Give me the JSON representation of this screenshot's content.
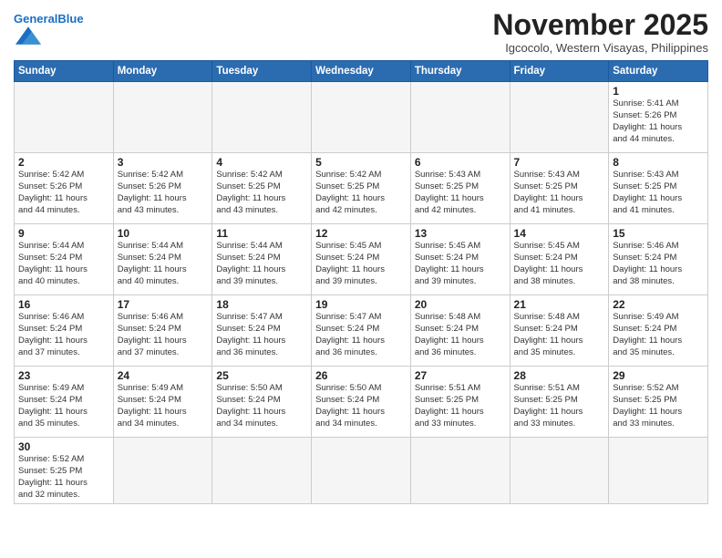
{
  "header": {
    "logo_general": "General",
    "logo_blue": "Blue",
    "month_title": "November 2025",
    "location": "Igcocolo, Western Visayas, Philippines"
  },
  "weekdays": [
    "Sunday",
    "Monday",
    "Tuesday",
    "Wednesday",
    "Thursday",
    "Friday",
    "Saturday"
  ],
  "weeks": [
    [
      {
        "day": "",
        "info": ""
      },
      {
        "day": "",
        "info": ""
      },
      {
        "day": "",
        "info": ""
      },
      {
        "day": "",
        "info": ""
      },
      {
        "day": "",
        "info": ""
      },
      {
        "day": "",
        "info": ""
      },
      {
        "day": "1",
        "info": "Sunrise: 5:41 AM\nSunset: 5:26 PM\nDaylight: 11 hours\nand 44 minutes."
      }
    ],
    [
      {
        "day": "2",
        "info": "Sunrise: 5:42 AM\nSunset: 5:26 PM\nDaylight: 11 hours\nand 44 minutes."
      },
      {
        "day": "3",
        "info": "Sunrise: 5:42 AM\nSunset: 5:26 PM\nDaylight: 11 hours\nand 43 minutes."
      },
      {
        "day": "4",
        "info": "Sunrise: 5:42 AM\nSunset: 5:25 PM\nDaylight: 11 hours\nand 43 minutes."
      },
      {
        "day": "5",
        "info": "Sunrise: 5:42 AM\nSunset: 5:25 PM\nDaylight: 11 hours\nand 42 minutes."
      },
      {
        "day": "6",
        "info": "Sunrise: 5:43 AM\nSunset: 5:25 PM\nDaylight: 11 hours\nand 42 minutes."
      },
      {
        "day": "7",
        "info": "Sunrise: 5:43 AM\nSunset: 5:25 PM\nDaylight: 11 hours\nand 41 minutes."
      },
      {
        "day": "8",
        "info": "Sunrise: 5:43 AM\nSunset: 5:25 PM\nDaylight: 11 hours\nand 41 minutes."
      }
    ],
    [
      {
        "day": "9",
        "info": "Sunrise: 5:44 AM\nSunset: 5:24 PM\nDaylight: 11 hours\nand 40 minutes."
      },
      {
        "day": "10",
        "info": "Sunrise: 5:44 AM\nSunset: 5:24 PM\nDaylight: 11 hours\nand 40 minutes."
      },
      {
        "day": "11",
        "info": "Sunrise: 5:44 AM\nSunset: 5:24 PM\nDaylight: 11 hours\nand 39 minutes."
      },
      {
        "day": "12",
        "info": "Sunrise: 5:45 AM\nSunset: 5:24 PM\nDaylight: 11 hours\nand 39 minutes."
      },
      {
        "day": "13",
        "info": "Sunrise: 5:45 AM\nSunset: 5:24 PM\nDaylight: 11 hours\nand 39 minutes."
      },
      {
        "day": "14",
        "info": "Sunrise: 5:45 AM\nSunset: 5:24 PM\nDaylight: 11 hours\nand 38 minutes."
      },
      {
        "day": "15",
        "info": "Sunrise: 5:46 AM\nSunset: 5:24 PM\nDaylight: 11 hours\nand 38 minutes."
      }
    ],
    [
      {
        "day": "16",
        "info": "Sunrise: 5:46 AM\nSunset: 5:24 PM\nDaylight: 11 hours\nand 37 minutes."
      },
      {
        "day": "17",
        "info": "Sunrise: 5:46 AM\nSunset: 5:24 PM\nDaylight: 11 hours\nand 37 minutes."
      },
      {
        "day": "18",
        "info": "Sunrise: 5:47 AM\nSunset: 5:24 PM\nDaylight: 11 hours\nand 36 minutes."
      },
      {
        "day": "19",
        "info": "Sunrise: 5:47 AM\nSunset: 5:24 PM\nDaylight: 11 hours\nand 36 minutes."
      },
      {
        "day": "20",
        "info": "Sunrise: 5:48 AM\nSunset: 5:24 PM\nDaylight: 11 hours\nand 36 minutes."
      },
      {
        "day": "21",
        "info": "Sunrise: 5:48 AM\nSunset: 5:24 PM\nDaylight: 11 hours\nand 35 minutes."
      },
      {
        "day": "22",
        "info": "Sunrise: 5:49 AM\nSunset: 5:24 PM\nDaylight: 11 hours\nand 35 minutes."
      }
    ],
    [
      {
        "day": "23",
        "info": "Sunrise: 5:49 AM\nSunset: 5:24 PM\nDaylight: 11 hours\nand 35 minutes."
      },
      {
        "day": "24",
        "info": "Sunrise: 5:49 AM\nSunset: 5:24 PM\nDaylight: 11 hours\nand 34 minutes."
      },
      {
        "day": "25",
        "info": "Sunrise: 5:50 AM\nSunset: 5:24 PM\nDaylight: 11 hours\nand 34 minutes."
      },
      {
        "day": "26",
        "info": "Sunrise: 5:50 AM\nSunset: 5:24 PM\nDaylight: 11 hours\nand 34 minutes."
      },
      {
        "day": "27",
        "info": "Sunrise: 5:51 AM\nSunset: 5:25 PM\nDaylight: 11 hours\nand 33 minutes."
      },
      {
        "day": "28",
        "info": "Sunrise: 5:51 AM\nSunset: 5:25 PM\nDaylight: 11 hours\nand 33 minutes."
      },
      {
        "day": "29",
        "info": "Sunrise: 5:52 AM\nSunset: 5:25 PM\nDaylight: 11 hours\nand 33 minutes."
      }
    ],
    [
      {
        "day": "30",
        "info": "Sunrise: 5:52 AM\nSunset: 5:25 PM\nDaylight: 11 hours\nand 32 minutes."
      },
      {
        "day": "",
        "info": ""
      },
      {
        "day": "",
        "info": ""
      },
      {
        "day": "",
        "info": ""
      },
      {
        "day": "",
        "info": ""
      },
      {
        "day": "",
        "info": ""
      },
      {
        "day": "",
        "info": ""
      }
    ]
  ]
}
